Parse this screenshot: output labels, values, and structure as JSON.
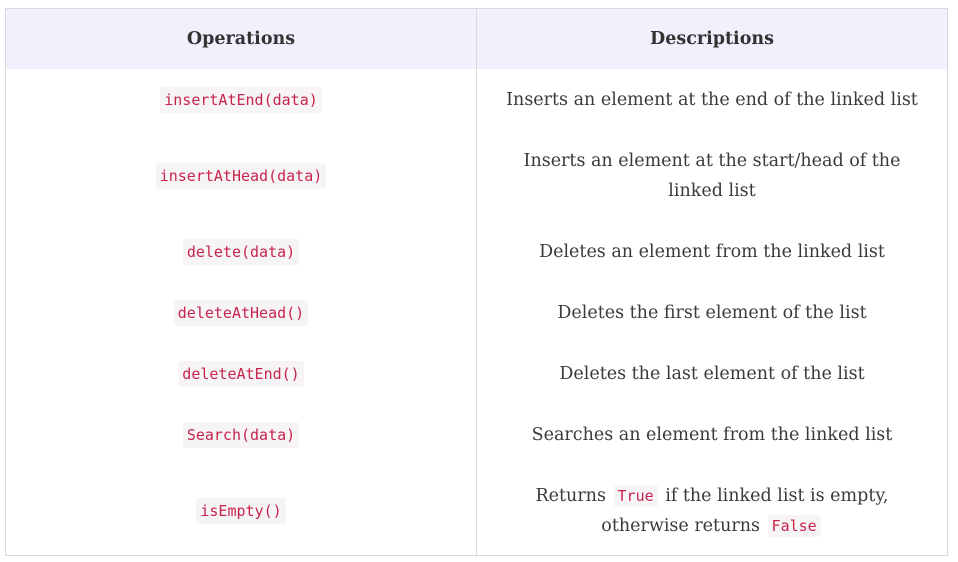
{
  "table": {
    "headers": {
      "operations": "Operations",
      "descriptions": "Descriptions"
    },
    "rows": [
      {
        "operation": "insertAtEnd(data)",
        "description": "Inserts an element at the end of the linked list"
      },
      {
        "operation": "insertAtHead(data)",
        "description": "Inserts an element at the start/head of the linked list"
      },
      {
        "operation": "delete(data)",
        "description": "Deletes an element from the linked list"
      },
      {
        "operation": "deleteAtHead()",
        "description": "Deletes the first element of the list"
      },
      {
        "operation": "deleteAtEnd()",
        "description": "Deletes the last element of the list"
      },
      {
        "operation": "Search(data)",
        "description": "Searches an element from the linked list"
      },
      {
        "operation": "isEmpty()",
        "description_parts": {
          "before": "Returns",
          "code_true": "True",
          "middle": "if the linked list is empty, otherwise returns",
          "code_false": "False"
        }
      }
    ]
  }
}
